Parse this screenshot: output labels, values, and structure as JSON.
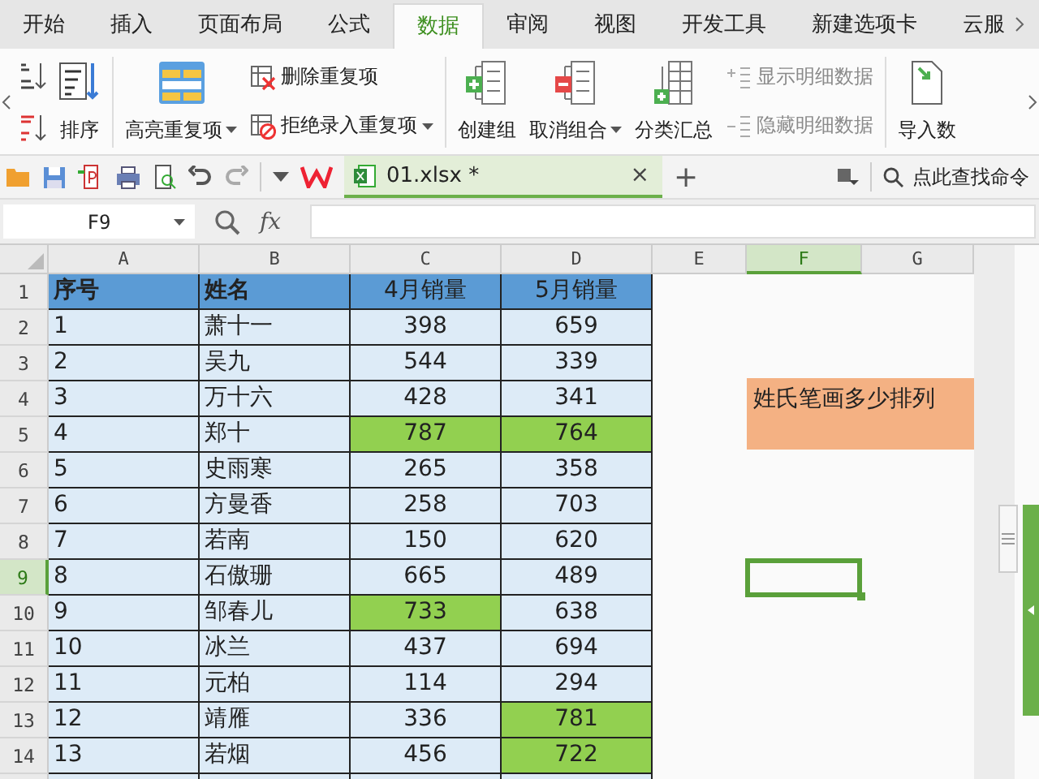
{
  "tabs": [
    {
      "label": "开始",
      "selected": false
    },
    {
      "label": "插入",
      "selected": false
    },
    {
      "label": "页面布局",
      "selected": false
    },
    {
      "label": "公式",
      "selected": false
    },
    {
      "label": "数据",
      "selected": true
    },
    {
      "label": "审阅",
      "selected": false
    },
    {
      "label": "视图",
      "selected": false
    },
    {
      "label": "开发工具",
      "selected": false
    },
    {
      "label": "新建选项卡",
      "selected": false
    },
    {
      "label": "云服",
      "selected": false
    }
  ],
  "ribbon": {
    "groups": [
      {
        "items": [
          {
            "kind": "sort",
            "label": "排序",
            "dropdown": false,
            "disabled": false
          }
        ]
      },
      {
        "items": [
          {
            "kind": "highlight",
            "label": "高亮重复项",
            "dropdown": true,
            "disabled": false
          }
        ]
      },
      {
        "items": [
          {
            "kind": "remove-dup",
            "label": "删除重复项",
            "dropdown": false,
            "disabled": false
          },
          {
            "kind": "reject-dup",
            "label": "拒绝录入重复项",
            "dropdown": true,
            "disabled": false
          }
        ]
      },
      {
        "items": [
          {
            "kind": "group",
            "label": "创建组",
            "dropdown": false,
            "disabled": false
          }
        ]
      },
      {
        "items": [
          {
            "kind": "ungroup",
            "label": "取消组合",
            "dropdown": true,
            "disabled": false
          }
        ]
      },
      {
        "items": [
          {
            "kind": "subtotal",
            "label": "分类汇总",
            "dropdown": false,
            "disabled": false
          }
        ]
      },
      {
        "items": [
          {
            "kind": "show-detail",
            "label": "显示明细数据",
            "dropdown": false,
            "disabled": true
          },
          {
            "kind": "hide-detail",
            "label": "隐藏明细数据",
            "dropdown": false,
            "disabled": true
          }
        ]
      },
      {
        "items": [
          {
            "kind": "import",
            "label": "导入数",
            "dropdown": false,
            "disabled": false
          }
        ]
      }
    ]
  },
  "toolbar": {
    "file_tab": {
      "label": "01.xlsx *",
      "close": "×"
    },
    "new_tab": "+",
    "search": "点此查找命令"
  },
  "formula_bar": {
    "name_box": "F9",
    "fx": "fx"
  },
  "sheet": {
    "columns": [
      {
        "label": "A",
        "selected": false
      },
      {
        "label": "B",
        "selected": false
      },
      {
        "label": "C",
        "selected": false
      },
      {
        "label": "D",
        "selected": false
      },
      {
        "label": "E",
        "selected": false
      },
      {
        "label": "F",
        "selected": true
      },
      {
        "label": "G",
        "selected": false
      }
    ],
    "rows": [
      {
        "number": "1",
        "selected": false,
        "kind": "header",
        "cells": [
          {
            "text": "序号",
            "highlighted": false
          },
          {
            "text": "姓名",
            "highlighted": false
          },
          {
            "text": "4月销量",
            "highlighted": false
          },
          {
            "text": "5月销量",
            "highlighted": false
          }
        ]
      },
      {
        "number": "2",
        "selected": false,
        "kind": "body",
        "cells": [
          {
            "text": "1",
            "highlighted": false
          },
          {
            "text": "萧十一",
            "highlighted": false
          },
          {
            "text": "398",
            "highlighted": false
          },
          {
            "text": "659",
            "highlighted": false
          }
        ]
      },
      {
        "number": "3",
        "selected": false,
        "kind": "body",
        "cells": [
          {
            "text": "2",
            "highlighted": false
          },
          {
            "text": "吴九",
            "highlighted": false
          },
          {
            "text": "544",
            "highlighted": false
          },
          {
            "text": "339",
            "highlighted": false
          }
        ]
      },
      {
        "number": "4",
        "selected": false,
        "kind": "body",
        "cells": [
          {
            "text": "3",
            "highlighted": false
          },
          {
            "text": "万十六",
            "highlighted": false
          },
          {
            "text": "428",
            "highlighted": false
          },
          {
            "text": "341",
            "highlighted": false
          }
        ]
      },
      {
        "number": "5",
        "selected": false,
        "kind": "body",
        "cells": [
          {
            "text": "4",
            "highlighted": false
          },
          {
            "text": "郑十",
            "highlighted": false
          },
          {
            "text": "787",
            "highlighted": true
          },
          {
            "text": "764",
            "highlighted": true
          }
        ]
      },
      {
        "number": "6",
        "selected": false,
        "kind": "body",
        "cells": [
          {
            "text": "5",
            "highlighted": false
          },
          {
            "text": "史雨寒",
            "highlighted": false
          },
          {
            "text": "265",
            "highlighted": false
          },
          {
            "text": "358",
            "highlighted": false
          }
        ]
      },
      {
        "number": "7",
        "selected": false,
        "kind": "body",
        "cells": [
          {
            "text": "6",
            "highlighted": false
          },
          {
            "text": "方曼香",
            "highlighted": false
          },
          {
            "text": "258",
            "highlighted": false
          },
          {
            "text": "703",
            "highlighted": false
          }
        ]
      },
      {
        "number": "8",
        "selected": false,
        "kind": "body",
        "cells": [
          {
            "text": "7",
            "highlighted": false
          },
          {
            "text": "若南",
            "highlighted": false
          },
          {
            "text": "150",
            "highlighted": false
          },
          {
            "text": "620",
            "highlighted": false
          }
        ]
      },
      {
        "number": "9",
        "selected": true,
        "kind": "body",
        "cells": [
          {
            "text": "8",
            "highlighted": false
          },
          {
            "text": "石傲珊",
            "highlighted": false
          },
          {
            "text": "665",
            "highlighted": false
          },
          {
            "text": "489",
            "highlighted": false
          }
        ]
      },
      {
        "number": "10",
        "selected": false,
        "kind": "body",
        "cells": [
          {
            "text": "9",
            "highlighted": false
          },
          {
            "text": "邹春儿",
            "highlighted": false
          },
          {
            "text": "733",
            "highlighted": true
          },
          {
            "text": "638",
            "highlighted": false
          }
        ]
      },
      {
        "number": "11",
        "selected": false,
        "kind": "body",
        "cells": [
          {
            "text": "10",
            "highlighted": false
          },
          {
            "text": "冰兰",
            "highlighted": false
          },
          {
            "text": "437",
            "highlighted": false
          },
          {
            "text": "694",
            "highlighted": false
          }
        ]
      },
      {
        "number": "12",
        "selected": false,
        "kind": "body",
        "cells": [
          {
            "text": "11",
            "highlighted": false
          },
          {
            "text": "元柏",
            "highlighted": false
          },
          {
            "text": "114",
            "highlighted": false
          },
          {
            "text": "294",
            "highlighted": false
          }
        ]
      },
      {
        "number": "13",
        "selected": false,
        "kind": "body",
        "cells": [
          {
            "text": "12",
            "highlighted": false
          },
          {
            "text": "靖雁",
            "highlighted": false
          },
          {
            "text": "336",
            "highlighted": false
          },
          {
            "text": "781",
            "highlighted": true
          }
        ]
      },
      {
        "number": "14",
        "selected": false,
        "kind": "body",
        "cells": [
          {
            "text": "13",
            "highlighted": false
          },
          {
            "text": "若烟",
            "highlighted": false
          },
          {
            "text": "456",
            "highlighted": false
          },
          {
            "text": "722",
            "highlighted": true
          }
        ]
      }
    ],
    "note": {
      "text": "姓氏笔画多少排列"
    }
  }
}
